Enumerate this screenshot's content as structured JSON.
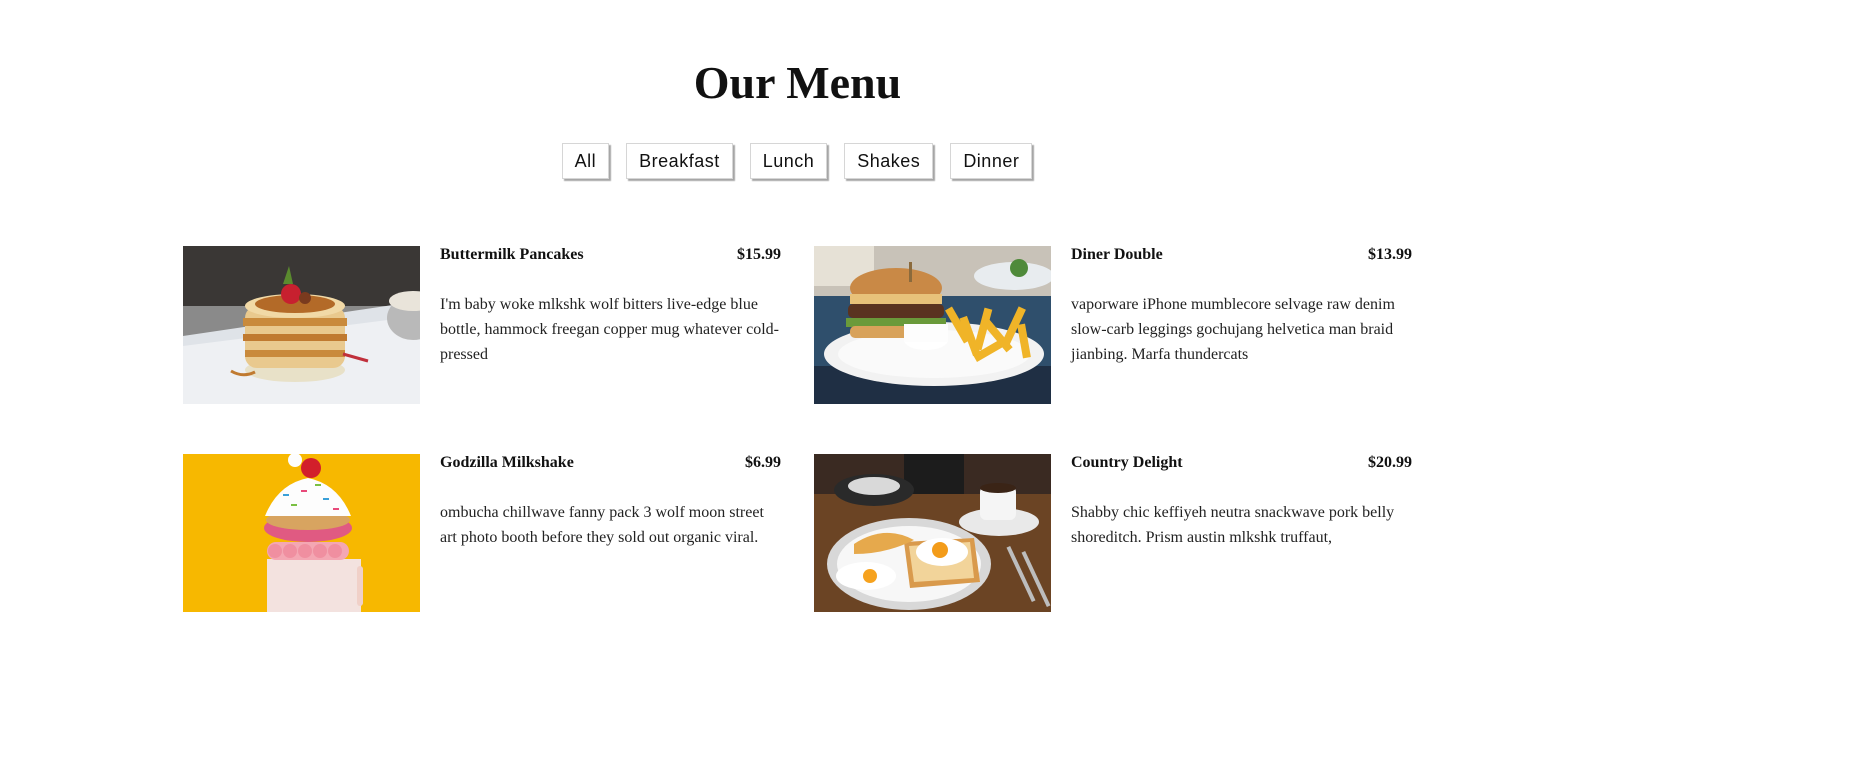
{
  "title": "Our Menu",
  "filters": [
    "All",
    "Breakfast",
    "Lunch",
    "Shakes",
    "Dinner"
  ],
  "items": [
    {
      "name": "Buttermilk Pancakes",
      "price": "$15.99",
      "description": "I'm baby woke mlkshk wolf bitters live-edge blue bottle, hammock freegan copper mug whatever cold-pressed",
      "image": "pancakes-photo"
    },
    {
      "name": "Diner Double",
      "price": "$13.99",
      "description": "vaporware iPhone mumblecore selvage raw denim slow-carb leggings gochujang helvetica man braid jianbing. Marfa thundercats",
      "image": "burger-photo"
    },
    {
      "name": "Godzilla Milkshake",
      "price": "$6.99",
      "description": "ombucha chillwave fanny pack 3 wolf moon street art photo booth before they sold out organic viral.",
      "image": "milkshake-photo"
    },
    {
      "name": "Country Delight",
      "price": "$20.99",
      "description": "Shabby chic keffiyeh neutra snackwave pork belly shoreditch. Prism austin mlkshk truffaut,",
      "image": "breakfast-plate-photo"
    }
  ],
  "colors": {
    "background": "#ffffff",
    "text": "#111111",
    "shake_background": "#f7b800"
  }
}
